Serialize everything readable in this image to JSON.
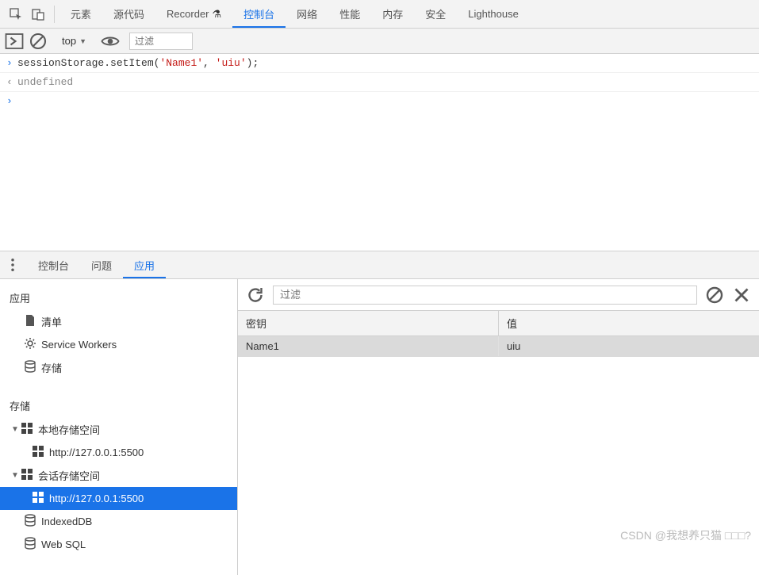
{
  "top_tabs": {
    "elements": "元素",
    "sources": "源代码",
    "recorder": "Recorder",
    "console": "控制台",
    "network": "网络",
    "performance": "性能",
    "memory": "内存",
    "security": "安全",
    "lighthouse": "Lighthouse"
  },
  "console_toolbar": {
    "scope": "top",
    "filter_placeholder": "过滤"
  },
  "console": {
    "input_prefix": "sessionStorage.setItem(",
    "arg1": "'Name1'",
    "sep": ", ",
    "arg2": "'uiu'",
    "input_suffix": ");",
    "result": "undefined"
  },
  "drawer_tabs": {
    "console": "控制台",
    "issues": "问题",
    "application": "应用"
  },
  "app_sidebar": {
    "section_application": "应用",
    "manifest": "清单",
    "service_workers": "Service Workers",
    "storage_item": "存储",
    "section_storage": "存储",
    "local_storage": "本地存储空间",
    "local_storage_origin": "http://127.0.0.1:5500",
    "session_storage": "会话存储空间",
    "session_storage_origin": "http://127.0.0.1:5500",
    "indexeddb": "IndexedDB",
    "websql": "Web SQL"
  },
  "storage_panel": {
    "filter_placeholder": "过滤",
    "col_key": "密钥",
    "col_value": "值",
    "rows": [
      {
        "key": "Name1",
        "value": "uiu"
      }
    ]
  },
  "watermark": "CSDN @我想养只猫 □□□?"
}
